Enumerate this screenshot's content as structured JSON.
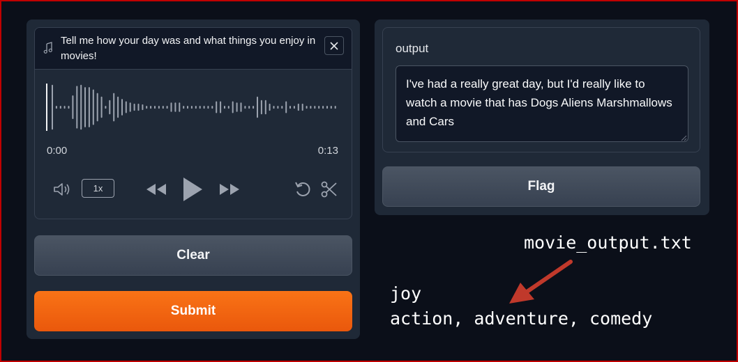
{
  "audio": {
    "label": "Tell me how your day was and what things you enjoy in movies!",
    "time_current": "0:00",
    "time_total": "0:13",
    "speed_label": "1x",
    "waveform_levels": [
      0.95,
      0.06,
      0.06,
      0.06,
      0.06,
      0.5,
      0.9,
      0.95,
      0.85,
      0.85,
      0.75,
      0.6,
      0.45,
      0.06,
      0.3,
      0.6,
      0.45,
      0.35,
      0.25,
      0.2,
      0.15,
      0.15,
      0.12,
      0.06,
      0.06,
      0.06,
      0.06,
      0.06,
      0.06,
      0.2,
      0.2,
      0.2,
      0.06,
      0.06,
      0.06,
      0.06,
      0.06,
      0.06,
      0.06,
      0.06,
      0.25,
      0.25,
      0.06,
      0.06,
      0.25,
      0.2,
      0.2,
      0.06,
      0.06,
      0.06,
      0.45,
      0.3,
      0.3,
      0.15,
      0.06,
      0.06,
      0.06,
      0.25,
      0.06,
      0.06,
      0.15,
      0.15,
      0.06,
      0.06,
      0.06,
      0.06,
      0.06,
      0.06,
      0.06,
      0.06
    ]
  },
  "buttons": {
    "clear": "Clear",
    "submit": "Submit",
    "flag": "Flag"
  },
  "output": {
    "label": "output",
    "text": "I've had a really great day, but I'd really like to watch a movie that has Dogs Aliens Marshmallows and Cars"
  },
  "annotation": {
    "filename": "movie_output.txt",
    "line1": "joy",
    "line2": "action, adventure, comedy",
    "arrow_color": "#c0392b"
  },
  "colors": {
    "background": "#0b0f19",
    "panel": "#1f2937",
    "submit_orange": "#f97316",
    "frame_red": "#c00000"
  }
}
